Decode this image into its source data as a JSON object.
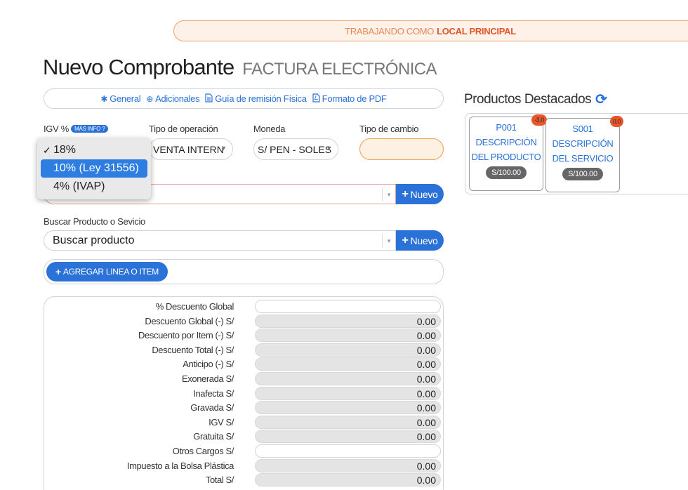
{
  "banner": {
    "prefix": "TRABAJANDO COMO",
    "location": "LOCAL PRINCIPAL"
  },
  "title": {
    "main": "Nuevo Comprobante",
    "sub": "FACTURA ELECTRÓNICA"
  },
  "tabs": [
    {
      "icon": "asterisk-icon",
      "label": "General"
    },
    {
      "icon": "plus-circle-icon",
      "label": "Adicionales"
    },
    {
      "icon": "file-text-icon",
      "label": "Guía de remisión Física"
    },
    {
      "icon": "file-pdf-icon",
      "label": "Formato de PDF"
    }
  ],
  "fields": {
    "igv_label": "IGV %",
    "igv_badge": "MÁS INFO",
    "tipo_operacion_label": "Tipo de operación",
    "tipo_operacion_value": "VENTA INTERNA",
    "moneda_label": "Moneda",
    "moneda_value": "S/ PEN - SOLES",
    "tipo_cambio_label": "Tipo de cambio"
  },
  "igv_dropdown": {
    "options": [
      "18%",
      "10% (Ley 31556)",
      "4% (IVAP)"
    ],
    "checked": "18%",
    "highlighted": "10% (Ley 31556)"
  },
  "client_search": {
    "new_label": "Nuevo"
  },
  "product_search": {
    "label": "Buscar Producto o Sevicio",
    "placeholder": "Buscar producto",
    "new_label": "Nuevo"
  },
  "add_line_label": "AGREGAR LINEA O ITEM",
  "totals": [
    {
      "label": "% Descuento Global",
      "value": "",
      "editable": true
    },
    {
      "label": "Descuento Global (-) S/",
      "value": "0.00"
    },
    {
      "label": "Descuento por Item (-) S/",
      "value": "0.00"
    },
    {
      "label": "Descuento Total (-) S/",
      "value": "0.00"
    },
    {
      "label": "Anticipo (-) S/",
      "value": "0.00"
    },
    {
      "label": "Exonerada S/",
      "value": "0.00"
    },
    {
      "label": "Inafecta S/",
      "value": "0.00"
    },
    {
      "label": "Gravada S/",
      "value": "0.00"
    },
    {
      "label": "IGV S/",
      "value": "0.00"
    },
    {
      "label": "Gratuita S/",
      "value": "0.00"
    },
    {
      "label": "Otros Cargos S/",
      "value": "",
      "editable": true
    },
    {
      "label": "Impuesto a la Bolsa Plástica",
      "value": "0.00"
    },
    {
      "label": "Total S/",
      "value": "0.00"
    }
  ],
  "featured": {
    "title": "Productos Destacados",
    "items": [
      {
        "code": "P001",
        "desc1": "DESCRIPCIÓN",
        "desc2": "DEL PRODUCTO",
        "price": "S/100.00",
        "stock": "-3.0"
      },
      {
        "code": "S001",
        "desc1": "DESCRIPCIÓN",
        "desc2": "DEL SERVICIO",
        "price": "S/100.00",
        "stock": "0.0"
      }
    ]
  }
}
